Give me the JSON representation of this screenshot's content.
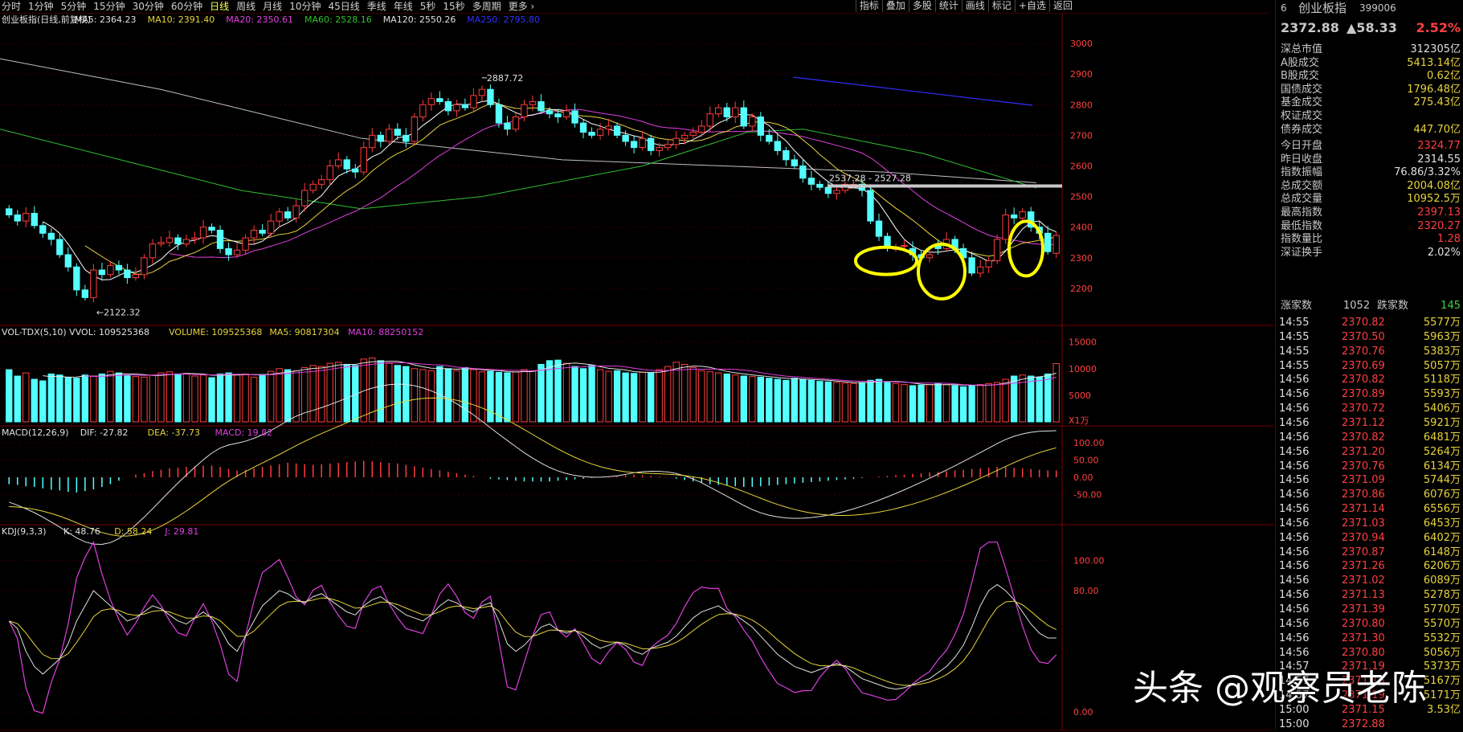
{
  "period_tabs": [
    "分时",
    "1分钟",
    "5分钟",
    "15分钟",
    "30分钟",
    "60分钟",
    "日线",
    "周线",
    "月线",
    "10分钟",
    "45日线",
    "季线",
    "年线",
    "5秒",
    "15秒",
    "多周期",
    "更多 ›"
  ],
  "active_period": "日线",
  "tool_tabs": [
    "指标",
    "叠加",
    "多股",
    "统计",
    "画线",
    "标记",
    "+自选",
    "返回"
  ],
  "main_legend": {
    "title": "创业板指(日线,前复权)",
    "ma5": "MA5: 2364.23",
    "ma10": "MA10: 2391.40",
    "ma20": "MA20: 2350.61",
    "ma60": "MA60: 2528.16",
    "ma120": "MA120: 2550.26",
    "ma250": "MA250: 2795.80"
  },
  "vol_legend": {
    "title": "VOL-TDX(5,10) VVOL: 109525368",
    "volume": "VOLUME: 109525368",
    "ma5": "MA5: 90817304",
    "ma10": "MA10: 88250152"
  },
  "macd_legend": {
    "title": "MACD(12,26,9)",
    "dif": "DIF: -27.82",
    "dea": "DEA: -37.73",
    "macd": "MACD: 19.82"
  },
  "kdj_legend": {
    "title": "KDJ(9,3,3)",
    "k": "K: 48.76",
    "d": "D: 58.24",
    "j": "J: 29.81"
  },
  "colors": {
    "up": "#ff3c3c",
    "down": "#54ffff",
    "ma5": "#ffffff",
    "ma10": "#e8d43c",
    "ma20": "#e040e0",
    "ma60": "#30c030",
    "ma120": "#c0c0c0",
    "ma250": "#3030ff",
    "highlight": "#ffff00"
  },
  "chart_data": [
    {
      "type": "candlestick",
      "title": "创业板指(日线,前复权)",
      "ylim": [
        2100,
        3050
      ],
      "y_ticks": [
        "3000",
        "2900",
        "2800",
        "2700",
        "2600",
        "2500",
        "2400",
        "2300",
        "2200"
      ],
      "annotations": {
        "high": "2887.72",
        "low": "2122.32",
        "range": "2537.28 - 2527.28"
      },
      "series": [
        {
          "name": "MA5",
          "values": [
            2364.23
          ]
        },
        {
          "name": "MA10",
          "values": [
            2391.4
          ]
        },
        {
          "name": "MA20",
          "values": [
            2350.61
          ]
        },
        {
          "name": "MA60",
          "values": [
            2528.16
          ]
        },
        {
          "name": "MA120",
          "values": [
            2550.26
          ]
        },
        {
          "name": "MA250",
          "values": [
            2795.8
          ]
        }
      ],
      "closes": [
        2440,
        2420,
        2445,
        2405,
        2380,
        2360,
        2310,
        2270,
        2195,
        2170,
        2260,
        2245,
        2275,
        2260,
        2235,
        2245,
        2300,
        2345,
        2350,
        2365,
        2345,
        2360,
        2365,
        2400,
        2390,
        2330,
        2310,
        2325,
        2365,
        2390,
        2380,
        2420,
        2450,
        2430,
        2470,
        2520,
        2540,
        2555,
        2600,
        2620,
        2590,
        2580,
        2660,
        2700,
        2680,
        2720,
        2700,
        2680,
        2760,
        2800,
        2820,
        2810,
        2780,
        2800,
        2790,
        2830,
        2850,
        2800,
        2740,
        2720,
        2760,
        2800,
        2810,
        2780,
        2770,
        2760,
        2780,
        2740,
        2710,
        2700,
        2720,
        2730,
        2700,
        2680,
        2660,
        2690,
        2650,
        2660,
        2670,
        2690,
        2700,
        2710,
        2730,
        2770,
        2790,
        2760,
        2790,
        2730,
        2760,
        2700,
        2680,
        2650,
        2620,
        2600,
        2560,
        2540,
        2530,
        2510,
        2520,
        2540,
        2540,
        2520,
        2420,
        2370,
        2340,
        2330,
        2340,
        2310,
        2300,
        2310,
        2330,
        2360,
        2330,
        2300,
        2250,
        2270,
        2290,
        2360,
        2440,
        2430,
        2450,
        2400,
        2380,
        2320,
        2372.88
      ],
      "opens": [
        2460,
        2440,
        2420,
        2445,
        2405,
        2380,
        2360,
        2310,
        2270,
        2195,
        2170,
        2260,
        2245,
        2275,
        2260,
        2235,
        2245,
        2300,
        2345,
        2350,
        2365,
        2345,
        2360,
        2365,
        2400,
        2390,
        2330,
        2310,
        2325,
        2365,
        2390,
        2380,
        2420,
        2450,
        2430,
        2470,
        2520,
        2540,
        2555,
        2600,
        2620,
        2590,
        2580,
        2660,
        2700,
        2680,
        2720,
        2700,
        2680,
        2760,
        2800,
        2820,
        2810,
        2780,
        2800,
        2790,
        2830,
        2850,
        2800,
        2740,
        2720,
        2760,
        2800,
        2810,
        2780,
        2770,
        2760,
        2780,
        2740,
        2710,
        2700,
        2720,
        2730,
        2700,
        2680,
        2660,
        2690,
        2650,
        2660,
        2670,
        2690,
        2700,
        2710,
        2730,
        2770,
        2790,
        2760,
        2790,
        2730,
        2760,
        2700,
        2680,
        2650,
        2620,
        2600,
        2560,
        2540,
        2530,
        2510,
        2520,
        2540,
        2540,
        2520,
        2420,
        2370,
        2330,
        2340,
        2330,
        2310,
        2300,
        2340,
        2330,
        2360,
        2330,
        2300,
        2250,
        2270,
        2290,
        2360,
        2440,
        2430,
        2450,
        2400,
        2380,
        2314.55
      ],
      "volumes": [
        98,
        86,
        92,
        80,
        77,
        90,
        88,
        84,
        82,
        88,
        86,
        90,
        95,
        92,
        87,
        85,
        84,
        88,
        92,
        94,
        90,
        91,
        86,
        88,
        83,
        90,
        92,
        88,
        90,
        84,
        89,
        95,
        100,
        98,
        96,
        102,
        106,
        104,
        110,
        112,
        108,
        106,
        118,
        120,
        115,
        110,
        106,
        104,
        100,
        98,
        96,
        104,
        100,
        96,
        102,
        98,
        94,
        95,
        93,
        92,
        94,
        98,
        96,
        108,
        115,
        116,
        110,
        104,
        100,
        106,
        98,
        95,
        96,
        92,
        91,
        93,
        92,
        98,
        104,
        112,
        108,
        102,
        96,
        94,
        92,
        90,
        88,
        86,
        85,
        84,
        82,
        80,
        78,
        82,
        80,
        78,
        76,
        75,
        74,
        73,
        72,
        74,
        78,
        80,
        75,
        72,
        70,
        68,
        69,
        70,
        72,
        70,
        68,
        66,
        68,
        70,
        72,
        74,
        80,
        86,
        88,
        86,
        84,
        90,
        109.5
      ],
      "macd": [
        -20,
        -22,
        -26,
        -28,
        -32,
        -36,
        -38,
        -42,
        -44,
        -40,
        -35,
        -28,
        -20,
        -10,
        0,
        8,
        12,
        18,
        22,
        26,
        28,
        30,
        32,
        34,
        34,
        30,
        24,
        20,
        22,
        26,
        30,
        34,
        38,
        42,
        40,
        38,
        36,
        38,
        40,
        42,
        44,
        46,
        48,
        46,
        44,
        42,
        40,
        36,
        32,
        28,
        24,
        20,
        16,
        12,
        8,
        4,
        0,
        -4,
        -6,
        -8,
        -10,
        -12,
        -12,
        -12,
        -12,
        -10,
        -8,
        -6,
        -4,
        -2,
        0,
        2,
        4,
        6,
        8,
        6,
        4,
        2,
        0,
        -4,
        -8,
        -12,
        -16,
        -20,
        -22,
        -24,
        -26,
        -28,
        -28,
        -26,
        -24,
        -22,
        -20,
        -18,
        -16,
        -14,
        -12,
        -10,
        -8,
        -6,
        -4,
        -2,
        0,
        2,
        4,
        6,
        8,
        10,
        12,
        14,
        16,
        18,
        20,
        22,
        24,
        26,
        28,
        30,
        30,
        28,
        26,
        24,
        22,
        20,
        19.82
      ],
      "kdj_k": [
        60,
        55,
        40,
        30,
        25,
        30,
        35,
        45,
        60,
        70,
        80,
        75,
        70,
        65,
        60,
        62,
        66,
        70,
        68,
        64,
        60,
        58,
        62,
        66,
        62,
        55,
        45,
        40,
        50,
        60,
        70,
        75,
        80,
        78,
        74,
        72,
        76,
        78,
        74,
        70,
        66,
        64,
        70,
        74,
        76,
        72,
        68,
        64,
        62,
        60,
        64,
        70,
        74,
        72,
        68,
        66,
        70,
        72,
        60,
        45,
        40,
        44,
        50,
        56,
        58,
        54,
        52,
        54,
        50,
        45,
        42,
        44,
        46,
        44,
        40,
        38,
        42,
        44,
        46,
        50,
        56,
        62,
        66,
        68,
        70,
        66,
        64,
        60,
        56,
        50,
        44,
        38,
        34,
        30,
        28,
        26,
        28,
        30,
        32,
        30,
        26,
        22,
        20,
        18,
        16,
        15,
        16,
        18,
        20,
        22,
        26,
        30,
        36,
        44,
        56,
        70,
        80,
        84,
        80,
        74,
        66,
        58,
        52,
        48.76,
        48.76
      ]
    }
  ],
  "y_ticks_vol": [
    "15000",
    "10000",
    "5000"
  ],
  "vol_unit": "X1万",
  "y_ticks_macd": [
    "100.00",
    "50.00",
    "0.00",
    "-50.00"
  ],
  "y_ticks_kdj": [
    "100.00",
    "80.00",
    "0.00"
  ],
  "quote": {
    "code_num": "6",
    "name": "创业板指",
    "code": "399006",
    "price": "2372.88",
    "change": "▲58.33",
    "pct": "2.52%"
  },
  "stats": [
    {
      "label": "深总市值",
      "value": "312305亿",
      "cls": "wht"
    },
    {
      "label": "A股成交",
      "value": "5413.14亿",
      "cls": "yel"
    },
    {
      "label": "B股成交",
      "value": "0.62亿",
      "cls": "yel"
    },
    {
      "label": "国债成交",
      "value": "1796.48亿",
      "cls": "yel"
    },
    {
      "label": "基金成交",
      "value": "275.43亿",
      "cls": "yel"
    },
    {
      "label": "权证成交",
      "value": "",
      "cls": "yel"
    },
    {
      "label": "债券成交",
      "value": "447.70亿",
      "cls": "yel"
    }
  ],
  "stats2": [
    {
      "label": "今日开盘",
      "value": "2324.77",
      "cls": "red"
    },
    {
      "label": "昨日收盘",
      "value": "2314.55",
      "cls": "wht"
    },
    {
      "label": "指数振幅",
      "value": "76.86/3.32%",
      "cls": "wht"
    },
    {
      "label": "总成交额",
      "value": "2004.08亿",
      "cls": "yel"
    },
    {
      "label": "总成交量",
      "value": "10952.5万",
      "cls": "yel"
    },
    {
      "label": "最高指数",
      "value": "2397.13",
      "cls": "red"
    },
    {
      "label": "最低指数",
      "value": "2320.27",
      "cls": "red"
    },
    {
      "label": "指数量比",
      "value": "1.28",
      "cls": "red"
    },
    {
      "label": "深证换手",
      "value": "2.02%",
      "cls": "wht"
    }
  ],
  "updown": {
    "up_label": "涨家数",
    "up_value": "1052",
    "down_label": "跌家数",
    "down_value": "145"
  },
  "ticks": [
    {
      "t": "14:55",
      "p": "2370.82",
      "v": "5577万"
    },
    {
      "t": "14:55",
      "p": "2370.50",
      "v": "5963万"
    },
    {
      "t": "14:55",
      "p": "2370.76",
      "v": "5383万"
    },
    {
      "t": "14:55",
      "p": "2370.69",
      "v": "5057万"
    },
    {
      "t": "14:56",
      "p": "2370.82",
      "v": "5118万"
    },
    {
      "t": "14:56",
      "p": "2370.89",
      "v": "5593万"
    },
    {
      "t": "14:56",
      "p": "2370.72",
      "v": "5406万"
    },
    {
      "t": "14:56",
      "p": "2371.12",
      "v": "5921万"
    },
    {
      "t": "14:56",
      "p": "2370.82",
      "v": "6481万"
    },
    {
      "t": "14:56",
      "p": "2371.20",
      "v": "5264万"
    },
    {
      "t": "14:56",
      "p": "2370.76",
      "v": "6134万"
    },
    {
      "t": "14:56",
      "p": "2371.09",
      "v": "5744万"
    },
    {
      "t": "14:56",
      "p": "2370.86",
      "v": "6076万"
    },
    {
      "t": "14:56",
      "p": "2371.14",
      "v": "6556万"
    },
    {
      "t": "14:56",
      "p": "2371.03",
      "v": "6453万"
    },
    {
      "t": "14:56",
      "p": "2370.94",
      "v": "6402万"
    },
    {
      "t": "14:56",
      "p": "2370.87",
      "v": "6148万"
    },
    {
      "t": "14:56",
      "p": "2371.26",
      "v": "6206万"
    },
    {
      "t": "14:56",
      "p": "2371.02",
      "v": "6089万"
    },
    {
      "t": "14:56",
      "p": "2371.13",
      "v": "5278万"
    },
    {
      "t": "14:56",
      "p": "2371.39",
      "v": "5770万"
    },
    {
      "t": "14:56",
      "p": "2370.80",
      "v": "5570万"
    },
    {
      "t": "14:56",
      "p": "2371.30",
      "v": "5532万"
    },
    {
      "t": "14:56",
      "p": "2370.80",
      "v": "5056万"
    },
    {
      "t": "14:57",
      "p": "2371.19",
      "v": "5373万"
    },
    {
      "t": "14:57",
      "p": "2371.15",
      "v": "5167万"
    },
    {
      "t": "14:57",
      "p": "2371.19",
      "v": "5171万"
    },
    {
      "t": "15:00",
      "p": "2371.15",
      "v": "3.53亿"
    },
    {
      "t": "15:00",
      "p": "2372.88",
      "v": ""
    }
  ],
  "watermark": "头条 @观察员老陈"
}
